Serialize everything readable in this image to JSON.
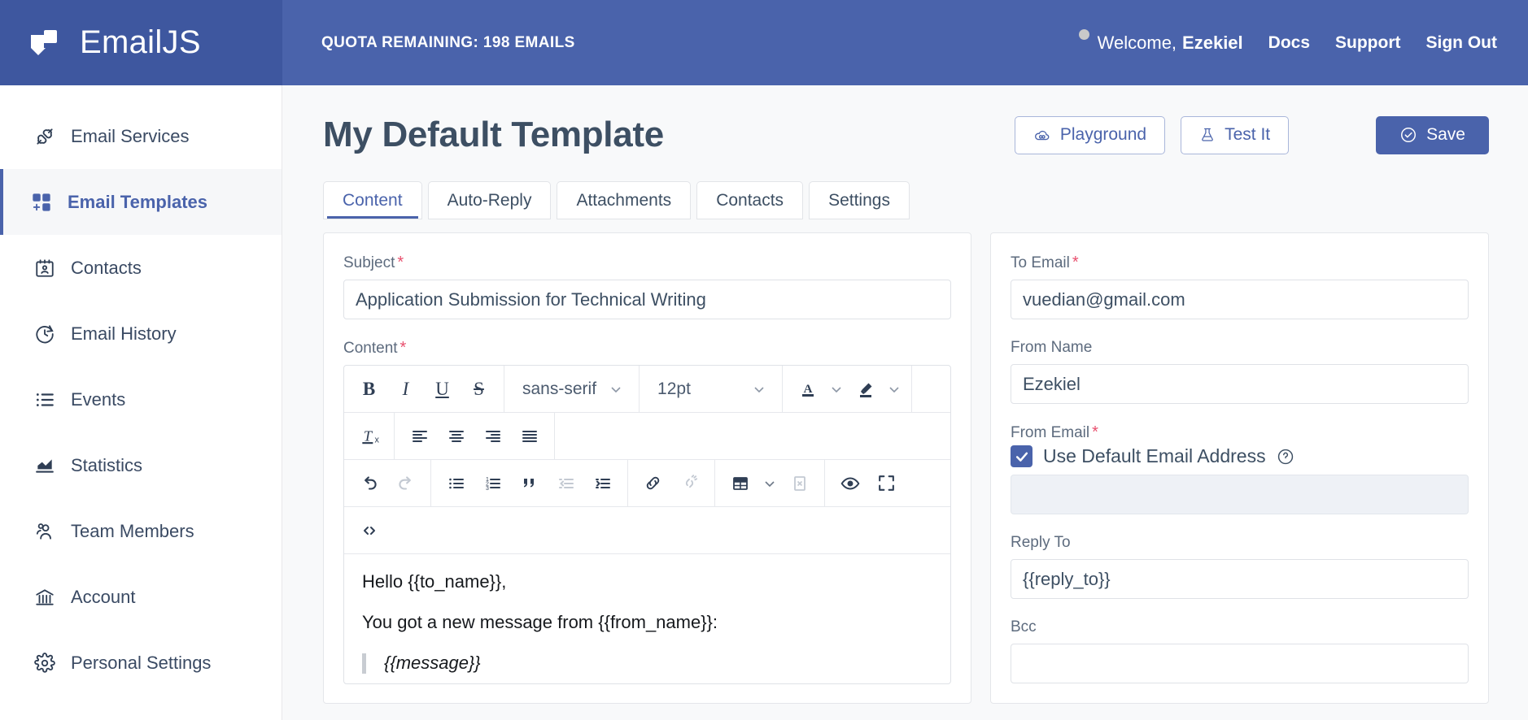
{
  "header": {
    "brand": "EmailJS",
    "brand_logo_icon": "emailjs-logo-icon",
    "quota": "QUOTA REMAINING: 198 EMAILS",
    "status_dot_icon": "status-dot-icon",
    "welcome_prefix": "Welcome,",
    "welcome_user": "Ezekiel",
    "links": [
      {
        "label": "Docs",
        "name": "docs"
      },
      {
        "label": "Support",
        "name": "support"
      },
      {
        "label": "Sign Out",
        "name": "sign-out"
      }
    ]
  },
  "sidebar": {
    "items": [
      {
        "label": "Email Services",
        "icon": "plug-icon",
        "active": false
      },
      {
        "label": "Email Templates",
        "icon": "templates-icon",
        "active": true
      },
      {
        "label": "Contacts",
        "icon": "contact-card-icon",
        "active": false
      },
      {
        "label": "Email History",
        "icon": "clock-icon",
        "active": false
      },
      {
        "label": "Events",
        "icon": "list-icon",
        "active": false
      },
      {
        "label": "Statistics",
        "icon": "chart-icon",
        "active": false
      },
      {
        "label": "Team Members",
        "icon": "people-icon",
        "active": false
      },
      {
        "label": "Account",
        "icon": "bank-icon",
        "active": false
      },
      {
        "label": "Personal Settings",
        "icon": "gear-icon",
        "active": false
      }
    ]
  },
  "page": {
    "title": "My Default Template",
    "actions": [
      {
        "label": "Playground",
        "icon": "cloud-infinity-icon",
        "style": "outline"
      },
      {
        "label": "Test It",
        "icon": "flask-icon",
        "style": "outline"
      },
      {
        "label": "Save",
        "icon": "check-circle-icon",
        "style": "primary"
      }
    ]
  },
  "tabs": [
    {
      "label": "Content",
      "active": true
    },
    {
      "label": "Auto-Reply",
      "active": false
    },
    {
      "label": "Attachments",
      "active": false
    },
    {
      "label": "Contacts",
      "active": false
    },
    {
      "label": "Settings",
      "active": false
    }
  ],
  "content_panel": {
    "subject_label": "Subject",
    "subject_required": "*",
    "subject_value": "Application Submission for Technical Writing",
    "subject_placeholder": "",
    "content_label": "Content",
    "content_required": "*",
    "toolbar": {
      "bold": "B",
      "italic": "I",
      "underline": "U",
      "strikethrough": "S",
      "font_family": "sans-serif",
      "font_size": "12pt",
      "text_color_icon": "text-color-icon",
      "highlight_color_icon": "highlight-color-icon",
      "clear_format_icon": "clear-formatting-icon",
      "align_left_icon": "align-left-icon",
      "align_center_icon": "align-center-icon",
      "align_right_icon": "align-right-icon",
      "align_justify_icon": "align-justify-icon",
      "undo_icon": "undo-icon",
      "redo_icon": "redo-icon",
      "bullet_list_icon": "bullet-list-icon",
      "numbered_list_icon": "numbered-list-icon",
      "blockquote_icon": "blockquote-icon",
      "outdent_icon": "outdent-icon",
      "indent_icon": "indent-icon",
      "link_icon": "link-icon",
      "unlink_icon": "unlink-icon",
      "table_icon": "table-icon",
      "delete_cell_icon": "delete-table-icon",
      "preview_icon": "preview-eye-icon",
      "fullscreen_icon": "fullscreen-icon",
      "source_code_icon": "source-code-icon"
    },
    "body": {
      "line1": "Hello {{to_name}},",
      "line2": "You got a new message from {{from_name}}:",
      "quote": "{{message}}"
    }
  },
  "settings_panel": {
    "fields": [
      {
        "label": "To Email",
        "required": "*",
        "value": "vuedian@gmail.com",
        "placeholder": "",
        "disabled": false
      },
      {
        "label": "From Name",
        "required": "",
        "value": "Ezekiel",
        "placeholder": "",
        "disabled": false
      }
    ],
    "from_email_label": "From Email",
    "from_email_required": "*",
    "use_default_label": "Use Default Email Address",
    "use_default_checked": true,
    "help_icon": "help-circle-icon",
    "check_icon": "checkmark-icon",
    "from_email_value": "",
    "from_email_placeholder": "",
    "reply_to_label": "Reply To",
    "reply_to_value": "{{reply_to}}",
    "bcc_label": "Bcc",
    "bcc_value": "",
    "bcc_placeholder": ""
  },
  "colors": {
    "brand_blue": "#4a63ab",
    "brand_blue_dark": "#3e579f",
    "text_dark": "#3d4f63",
    "required_red": "#e8506e",
    "panel_bg": "#f8f9fa"
  }
}
